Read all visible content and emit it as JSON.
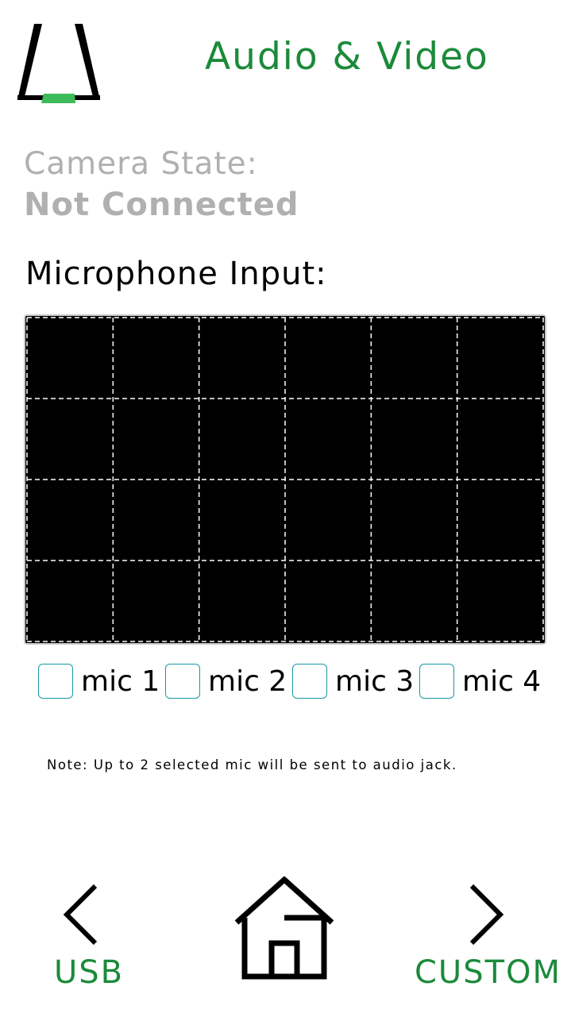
{
  "header": {
    "logo_icon": "a-logo-icon",
    "title": "Audio & Video",
    "title_color": "#1b8a3a",
    "logo_accent_color": "#3dbb5a"
  },
  "camera": {
    "label": "Camera State:",
    "value": "Not Connected"
  },
  "microphone": {
    "label": "Microphone Input:",
    "grid": {
      "columns": 6,
      "rows": 4,
      "background": "#000000",
      "line_color": "#ffffff"
    },
    "mics": [
      {
        "label": "mic 1",
        "checked": false
      },
      {
        "label": "mic 2",
        "checked": false
      },
      {
        "label": "mic 3",
        "checked": false
      },
      {
        "label": "mic 4",
        "checked": false
      }
    ],
    "checkbox_border_color": "#1a97a6",
    "note": "Note: Up to 2 selected mic will be sent to audio jack."
  },
  "nav": {
    "back": {
      "icon": "chevron-left-icon",
      "label": "USB"
    },
    "home": {
      "icon": "home-icon"
    },
    "next": {
      "icon": "chevron-right-icon",
      "label": "CUSTOM"
    }
  }
}
